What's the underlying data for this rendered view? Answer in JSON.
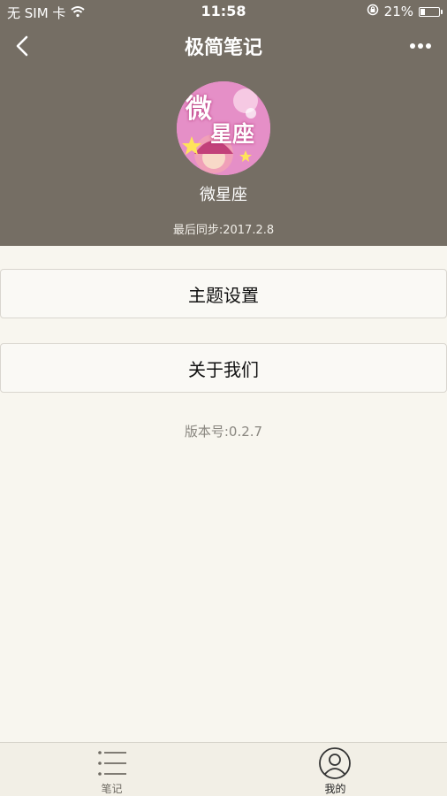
{
  "status": {
    "carrier": "无 SIM 卡",
    "time": "11:58",
    "battery_percent": "21%",
    "battery_level": 0.21
  },
  "nav": {
    "title": "极简笔记"
  },
  "profile": {
    "avatar_text_top": "微",
    "avatar_text_bottom": "星座",
    "username": "微星座",
    "sync_label": "最后同步:2017.2.8"
  },
  "menu": {
    "theme_settings": "主题设置",
    "about_us": "关于我们"
  },
  "version_label": "版本号:0.2.7",
  "tabs": [
    {
      "label": "笔记",
      "icon": "list-icon",
      "active": false
    },
    {
      "label": "我的",
      "icon": "user-icon",
      "active": true
    }
  ],
  "colors": {
    "header_bg": "#756e64",
    "page_bg": "#f8f6ef",
    "tabbar_bg": "#f2efe6"
  }
}
